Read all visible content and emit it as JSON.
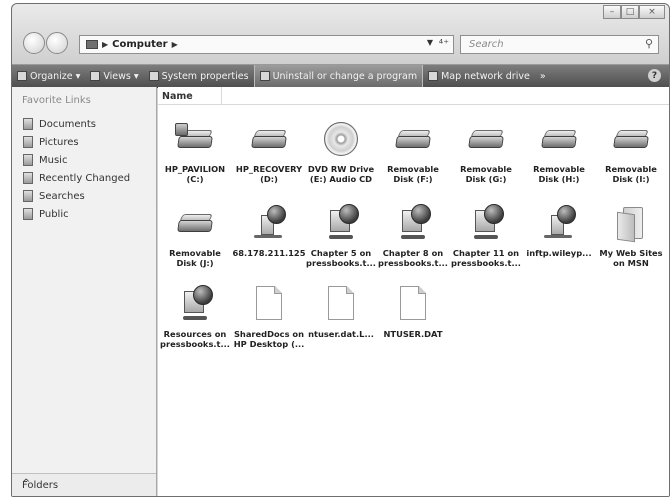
{
  "window": {
    "caption_buttons": {
      "minimize": "–",
      "maximize": "□",
      "close": "×"
    }
  },
  "address": {
    "crumb": "Computer",
    "refresh_icon": "refresh-icon"
  },
  "search": {
    "placeholder": "Search"
  },
  "toolbar": {
    "items": [
      {
        "label": "Organize",
        "icon": "organize-icon",
        "dropdown": true
      },
      {
        "label": "Views",
        "icon": "views-icon",
        "dropdown": true
      },
      {
        "label": "System properties",
        "icon": "system-properties-icon"
      },
      {
        "label": "Uninstall or change a program",
        "icon": "uninstall-icon"
      },
      {
        "label": "Map network drive",
        "icon": "map-network-drive-icon"
      }
    ],
    "more": "»",
    "help": "?"
  },
  "left_pane": {
    "title": "Favorite Links",
    "links": [
      {
        "label": "Documents",
        "icon": "documents-icon"
      },
      {
        "label": "Pictures",
        "icon": "pictures-icon"
      },
      {
        "label": "Music",
        "icon": "music-icon"
      },
      {
        "label": "Recently Changed",
        "icon": "recently-changed-icon"
      },
      {
        "label": "Searches",
        "icon": "searches-icon"
      },
      {
        "label": "Public",
        "icon": "public-icon"
      }
    ],
    "folders_label": "Folders",
    "folders_toggle": "^"
  },
  "content": {
    "column_header": "Name",
    "items": [
      {
        "l1": "HP_PAVILION",
        "l2": "(C:)",
        "type": "system-drive"
      },
      {
        "l1": "HP_RECOVERY",
        "l2": "(D:)",
        "type": "drive"
      },
      {
        "l1": "DVD RW Drive",
        "l2": "(E:) Audio CD",
        "type": "cd"
      },
      {
        "l1": "Removable",
        "l2": "Disk (F:)",
        "type": "drive"
      },
      {
        "l1": "Removable",
        "l2": "Disk (G:)",
        "type": "drive"
      },
      {
        "l1": "Removable",
        "l2": "Disk (H:)",
        "type": "drive"
      },
      {
        "l1": "Removable",
        "l2": "Disk (I:)",
        "type": "drive"
      },
      {
        "l1": "Removable",
        "l2": "Disk (J:)",
        "type": "drive"
      },
      {
        "l1": "68.178.211.125",
        "l2": "",
        "type": "ftp"
      },
      {
        "l1": "Chapter 5 on",
        "l2": "pressbooks.t...",
        "type": "net"
      },
      {
        "l1": "Chapter 8 on",
        "l2": "pressbooks.t...",
        "type": "net"
      },
      {
        "l1": "Chapter 11 on",
        "l2": "pressbooks.t...",
        "type": "net"
      },
      {
        "l1": "inftp.wileyp...",
        "l2": "",
        "type": "ftp"
      },
      {
        "l1": "My Web Sites",
        "l2": "on MSN",
        "type": "folder"
      },
      {
        "l1": "Resources on",
        "l2": "pressbooks.t...",
        "type": "net"
      },
      {
        "l1": "SharedDocs on",
        "l2": "HP Desktop (...",
        "type": "doc"
      },
      {
        "l1": "ntuser.dat.L...",
        "l2": "",
        "type": "doc"
      },
      {
        "l1": "NTUSER.DAT",
        "l2": "",
        "type": "doc"
      }
    ]
  }
}
